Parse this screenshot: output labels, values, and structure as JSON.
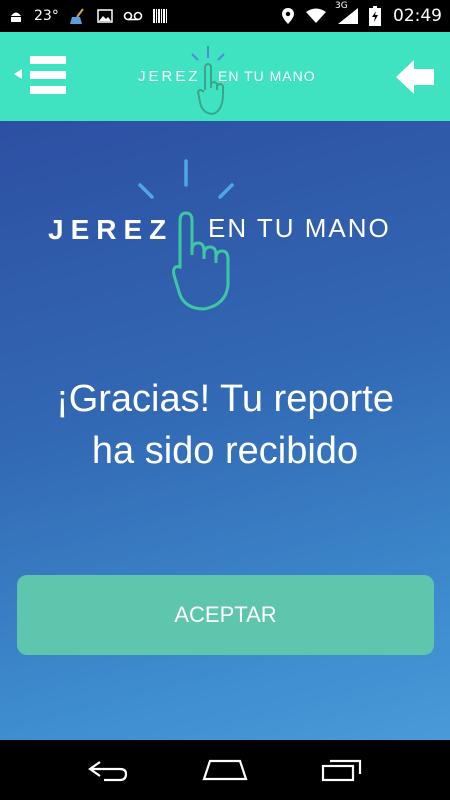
{
  "statusbar": {
    "temperature": "23°",
    "time": "02:49",
    "network": "3G",
    "icons": [
      "android-icon",
      "cleaner-icon",
      "image-icon",
      "voicemail-icon",
      "barcode-icon",
      "location-icon",
      "wifi-icon",
      "signal-icon",
      "battery-icon"
    ]
  },
  "header": {
    "logo_left": "JEREZ",
    "logo_right": "EN TU MANO",
    "accent": "#3fe3c2"
  },
  "main": {
    "logo_left": "JEREZ",
    "logo_right": "EN TU MANO",
    "message_line1": "¡Gracias! Tu reporte",
    "message_line2": "ha sido recibido",
    "accept_label": "ACEPTAR",
    "button_color": "#5fc6ae"
  },
  "navbar": {
    "icons": [
      "back-nav-icon",
      "home-nav-icon",
      "recents-nav-icon"
    ]
  }
}
